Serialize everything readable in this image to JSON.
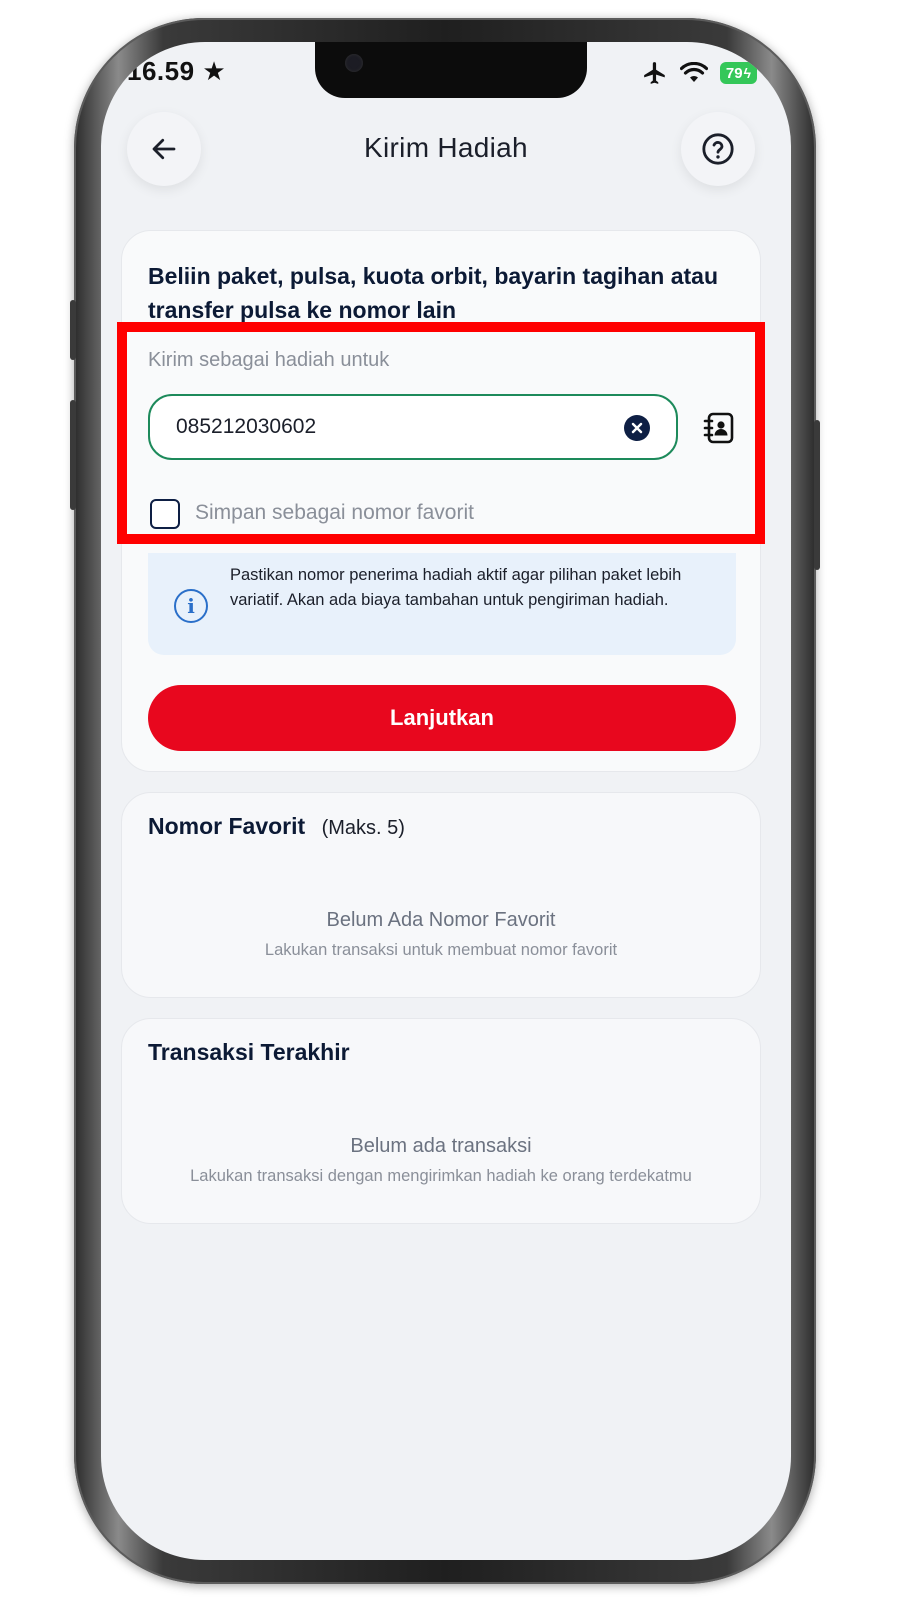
{
  "status_bar": {
    "time": "16.59",
    "battery": "79"
  },
  "header": {
    "title": "Kirim Hadiah"
  },
  "main_card": {
    "heading": "Beliin paket, pulsa, kuota orbit, bayarin tagihan atau transfer pulsa ke nomor lain",
    "field_label": "Kirim sebagai hadiah untuk",
    "phone_value": "085212030602",
    "save_favorite_label": "Simpan sebagai nomor favorit",
    "save_favorite_checked": false,
    "info_text": "Pastikan nomor penerima hadiah aktif agar pilihan paket lebih variatif. Akan ada biaya tambahan untuk pengiriman hadiah.",
    "continue_label": "Lanjutkan"
  },
  "favorites": {
    "title": "Nomor Favorit",
    "subtitle": "(Maks. 5)",
    "empty_title": "Belum Ada Nomor Favorit",
    "empty_desc": "Lakukan transaksi untuk membuat nomor favorit"
  },
  "transactions": {
    "title": "Transaksi Terakhir",
    "empty_title": "Belum ada transaksi",
    "empty_desc": "Lakukan transaksi dengan mengirimkan hadiah ke orang terdekatmu"
  },
  "colors": {
    "primary": "#e8071e",
    "input_border": "#1d8a5b",
    "navy": "#0e1f44",
    "info_bg": "#e8f1fb",
    "highlight": "#ff0000"
  },
  "icons": [
    "star-icon",
    "airplane-icon",
    "wifi-icon",
    "battery-icon",
    "back-arrow-icon",
    "help-icon",
    "clear-icon",
    "contact-book-icon",
    "info-icon"
  ]
}
